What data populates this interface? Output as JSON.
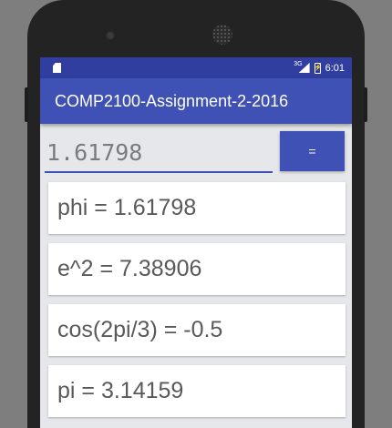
{
  "status_bar": {
    "network": "3G",
    "time": "6:01"
  },
  "app_bar": {
    "title": "COMP2100-Assignment-2-2016"
  },
  "input": {
    "value": "1.61798"
  },
  "equals_button": {
    "label": "="
  },
  "results": [
    "phi = 1.61798",
    "e^2 = 7.38906",
    "cos(2pi/3) = -0.5",
    "pi = 3.14159"
  ],
  "colors": {
    "primary": "#3f51b5",
    "primary_dark": "#303f9f",
    "background": "#e6e7ea"
  }
}
